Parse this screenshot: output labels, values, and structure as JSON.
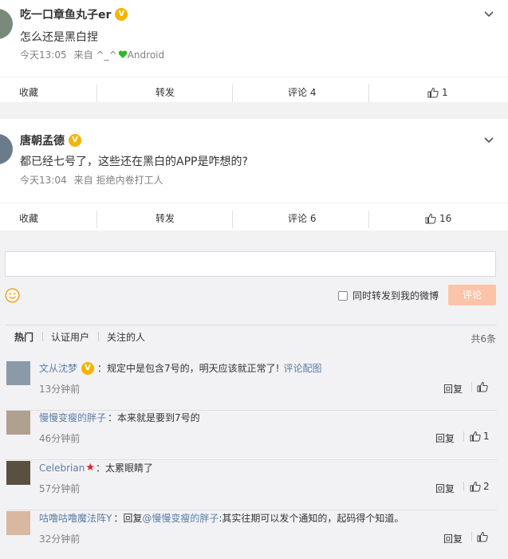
{
  "posts": [
    {
      "name": "吃一口章鱼丸子er",
      "badge": "V",
      "text": "怎么还是黑白捏",
      "time": "今天13:05",
      "source_prefix": "来自",
      "source": "^_^",
      "source_suffix": "Android",
      "actions": {
        "fav": "收藏",
        "repost": "转发",
        "comment": "评论 4",
        "like": "1"
      }
    },
    {
      "name": "唐朝孟德",
      "badge": "V",
      "text": "都已经七号了，这些还在黑白的APP是咋想的?",
      "time": "今天13:04",
      "source_prefix": "来自",
      "source": "拒绝内卷打工人",
      "actions": {
        "fav": "收藏",
        "repost": "转发",
        "comment": "评论 6",
        "like": "16"
      }
    }
  ],
  "comment_box": {
    "placeholder": "",
    "repost_label": "同时转发到我的微博",
    "submit_label": "评论"
  },
  "tabs": [
    "热门",
    "认证用户",
    "关注的人"
  ],
  "total": "共6条",
  "comments": [
    {
      "user": "文从沈梦",
      "badge": "V",
      "text": "：规定中是包含7号的，明天应该就正常了!",
      "link": "评论配图",
      "time": "13分钟前",
      "reply": "回复",
      "likes": ""
    },
    {
      "user": "慢慢变瘦的胖子",
      "text": "：本来就是要到7号的",
      "time": "46分钟前",
      "reply": "回复",
      "likes": "1"
    },
    {
      "user": "Celebrian",
      "star": "★",
      "text": "：太累眼睛了",
      "time": "57分钟前",
      "reply": "回复",
      "likes": "2"
    },
    {
      "user": "咕噜咕噜魔法阵Y",
      "text_prefix": "：回复",
      "mention": "@慢慢变瘦的胖子",
      "text": ":其实往期可以发个通知的，起码得个知道。",
      "time": "32分钟前",
      "reply": "回复",
      "likes": ""
    }
  ],
  "colors": {
    "link": "#5b7ea5",
    "badge": "#f5b400",
    "submit_disabled": "#fbc4a8",
    "heart": "#2eb82e",
    "star": "#e02020"
  }
}
